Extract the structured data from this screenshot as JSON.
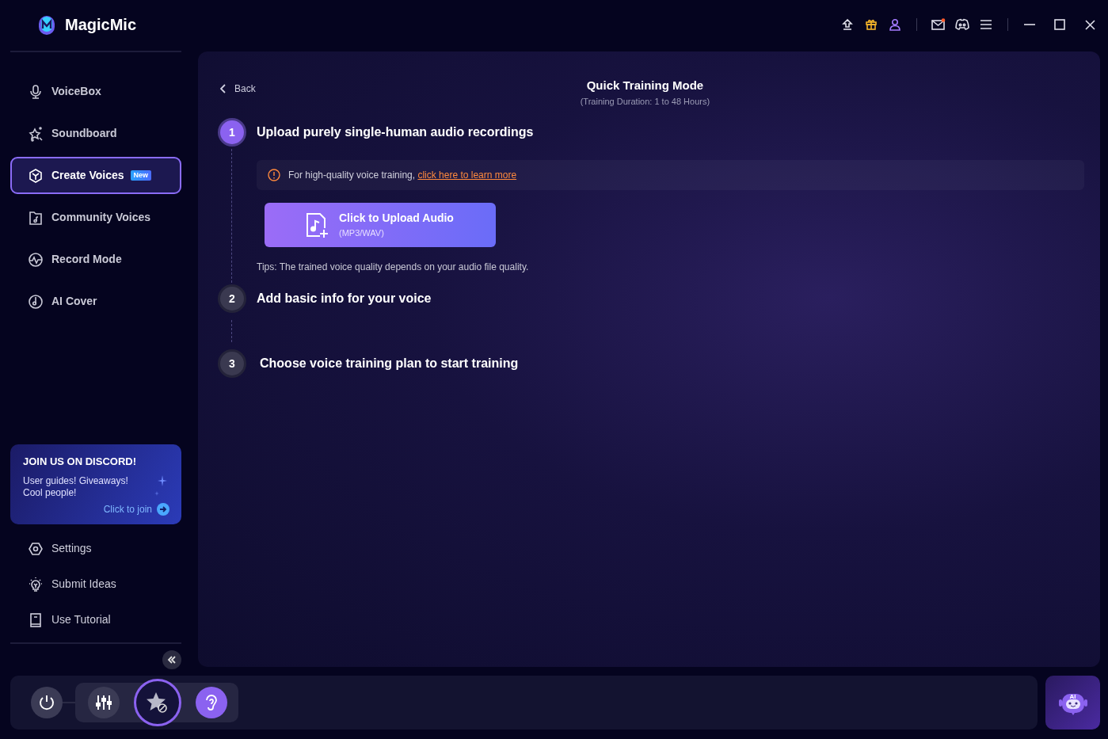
{
  "app": {
    "title": "MagicMic"
  },
  "title_bar": {
    "mail_unread": true
  },
  "nav_items": [
    {
      "label": "VoiceBox",
      "selected": false
    },
    {
      "label": "Soundboard",
      "selected": false
    },
    {
      "label": "Create Voices",
      "selected": true,
      "badge": "New"
    },
    {
      "label": "Community Voices",
      "selected": false
    },
    {
      "label": "Record Mode",
      "selected": false
    },
    {
      "label": "AI Cover",
      "selected": false
    }
  ],
  "discord_card": {
    "title": "JOIN US ON DISCORD!",
    "text": "User guides! Giveaways! Cool people!",
    "link": "Click to join"
  },
  "footer_items": [
    {
      "label": "Settings"
    },
    {
      "label": "Submit Ideas"
    },
    {
      "label": "Use Tutorial"
    }
  ],
  "page_header": {
    "back": "Back",
    "title": "Quick Training Mode",
    "subtitle": "(Training Duration: 1 to 48 Hours)"
  },
  "steps": [
    {
      "number": "1",
      "title": "Upload purely single-human audio recordings",
      "selected": true
    },
    {
      "number": "2",
      "title": "Add basic info for your voice",
      "selected": false
    },
    {
      "number": "3",
      "title": "Choose voice training plan to start training",
      "selected": false
    }
  ],
  "notice": {
    "text": "For high-quality voice training, ",
    "link": "click here to learn more"
  },
  "upload": {
    "title": "Click to Upload Audio",
    "formats": "(MP3/WAV)"
  },
  "tips": "Tips: The trained voice quality depends on your audio file quality.",
  "bottom_controls": [
    {
      "kind": "power"
    },
    {
      "kind": "mixer"
    },
    {
      "kind": "voice",
      "on": true
    },
    {
      "kind": "ear",
      "on": true
    }
  ],
  "assistant": {
    "label": "AI"
  }
}
